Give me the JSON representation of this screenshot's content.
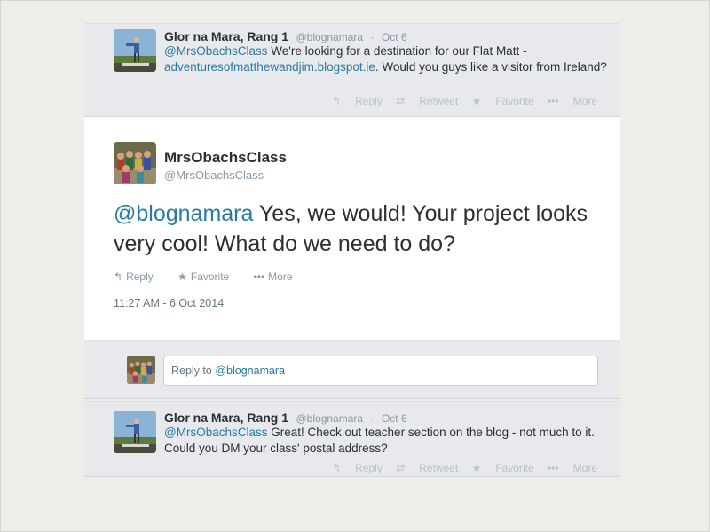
{
  "tweet1": {
    "name": "Glor na Mara, Rang 1",
    "handle": "@blognamara",
    "sep": "·",
    "date": "Oct 6",
    "mention": "@MrsObachsClass",
    "text_a": " We're looking for a destination for our Flat Matt - ",
    "link": "adventuresofmatthewandjim.blogspot.ie",
    "text_b": ". Would you guys like a visitor from Ireland?",
    "actions": {
      "reply": "Reply",
      "retweet": "Retweet",
      "favorite": "Favorite",
      "more": "More"
    }
  },
  "main_tweet": {
    "name": "MrsObachsClass",
    "handle": "@MrsObachsClass",
    "mention": "@blognamara",
    "text": " Yes, we would!  Your project looks very cool!  What do we need to do?",
    "actions": {
      "reply": "Reply",
      "favorite": "Favorite",
      "more": "More"
    },
    "timestamp": "11:27 AM - 6 Oct 2014"
  },
  "reply_box": {
    "prefix": "Reply to ",
    "mention": "@blognamara"
  },
  "tweet2": {
    "name": "Glor na Mara, Rang 1",
    "handle": "@blognamara",
    "sep": "·",
    "date": "Oct 6",
    "mention": "@MrsObachsClass",
    "text": " Great! Check out teacher section on the blog - not much to it. Could you DM your class' postal address?",
    "actions": {
      "reply": "Reply",
      "retweet": "Retweet",
      "favorite": "Favorite",
      "more": "More"
    }
  },
  "icons": {
    "reply": "reply-icon",
    "retweet": "retweet-icon",
    "favorite": "star-icon",
    "more": "more-dots-icon"
  },
  "colors": {
    "mention": "#2a7aa2",
    "card_grey": "#e7e9ec",
    "page_bg": "#ededea"
  }
}
